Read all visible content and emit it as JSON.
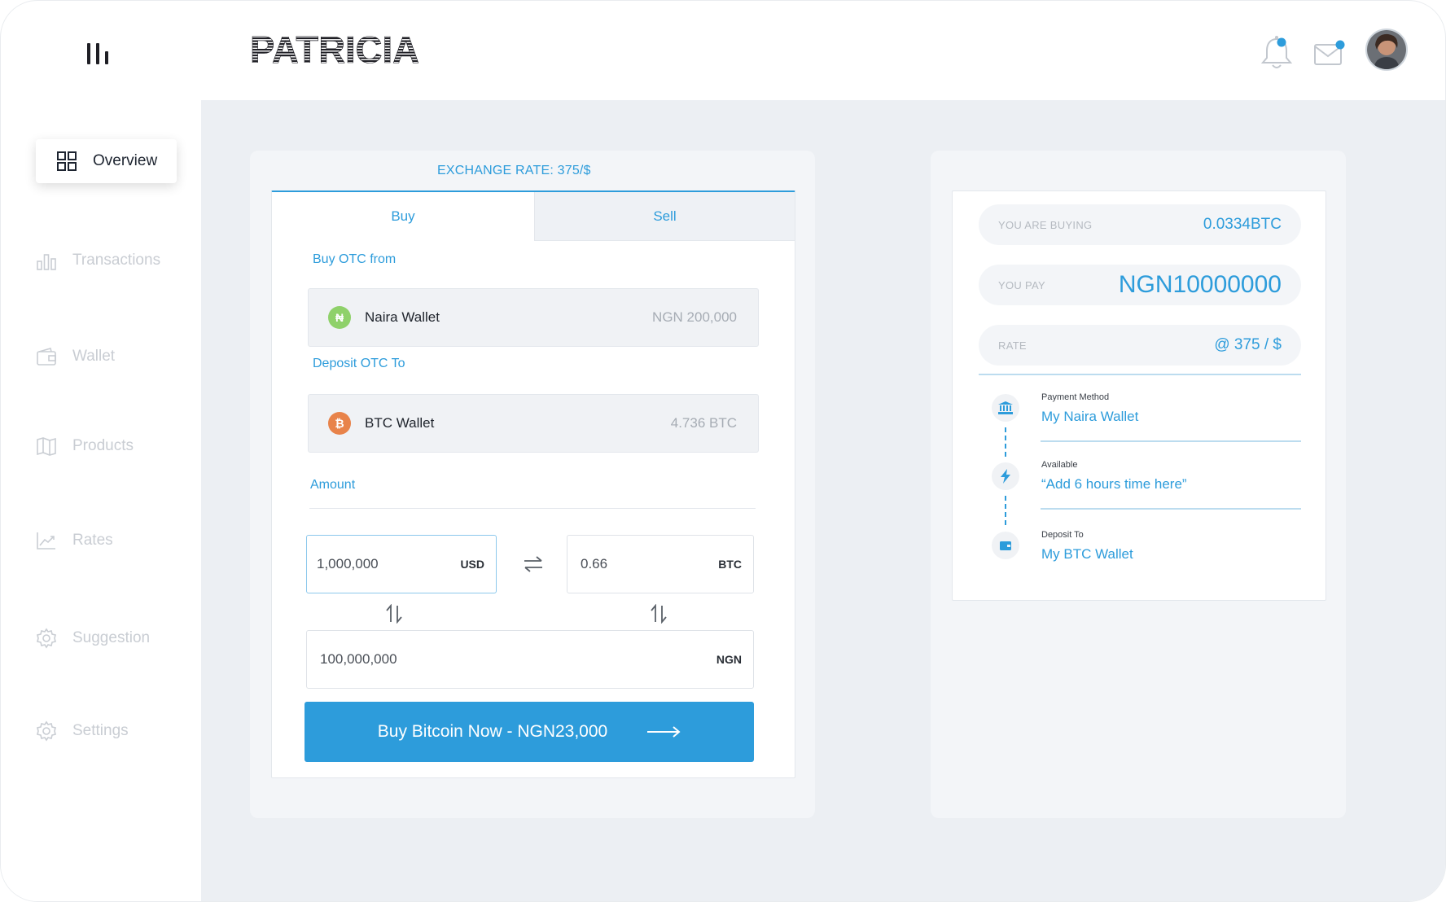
{
  "brand": {
    "name": "PATRICIA"
  },
  "header": {
    "notification_icon": "bell-icon",
    "mail_icon": "mail-icon",
    "accent": "#2d9cdb"
  },
  "sidebar": {
    "items": [
      {
        "label": "Overview",
        "icon": "grid-icon",
        "active": true
      },
      {
        "label": "Transactions",
        "icon": "bar-chart-icon",
        "active": false
      },
      {
        "label": "Wallet",
        "icon": "wallet-icon",
        "active": false
      },
      {
        "label": "Products",
        "icon": "map-icon",
        "active": false
      },
      {
        "label": "Rates",
        "icon": "trend-icon",
        "active": false
      },
      {
        "label": "Suggestion",
        "icon": "gear-icon",
        "active": false
      },
      {
        "label": "Settings",
        "icon": "gear-icon",
        "active": false
      }
    ]
  },
  "trade": {
    "exchange_rate": "EXCHANGE RATE: 375/$",
    "tabs": {
      "buy": "Buy",
      "sell": "Sell"
    },
    "from_label": "Buy OTC from",
    "from_wallet": {
      "name": "Naira Wallet",
      "balance": "NGN 200,000",
      "symbol": "₦",
      "color": "#8fd16a"
    },
    "to_label": "Deposit OTC To",
    "to_wallet": {
      "name": "BTC Wallet",
      "balance": "4.736 BTC",
      "symbol": "₿",
      "color": "#e8834a"
    },
    "amount_label": "Amount",
    "usd": {
      "value": "1,000,000",
      "currency": "USD"
    },
    "btc": {
      "value": "0.66",
      "currency": "BTC"
    },
    "ngn": {
      "value": "100,000,000",
      "currency": "NGN"
    },
    "buy_button": "Buy Bitcoin Now - NGN23,000"
  },
  "summary": {
    "buying": {
      "label": "YOU ARE BUYING",
      "value": "0.0334BTC"
    },
    "pay": {
      "label": "YOU PAY",
      "value": "NGN10000000"
    },
    "rate": {
      "label": "RATE",
      "value": "@ 375 / $"
    },
    "steps": [
      {
        "key": "Payment Method",
        "value": "My Naira Wallet",
        "icon": "bank-icon"
      },
      {
        "key": "Available",
        "value": "“Add 6 hours time here”",
        "icon": "lightning-icon"
      },
      {
        "key": "Deposit To",
        "value": "My BTC Wallet",
        "icon": "wallet-icon"
      }
    ]
  }
}
